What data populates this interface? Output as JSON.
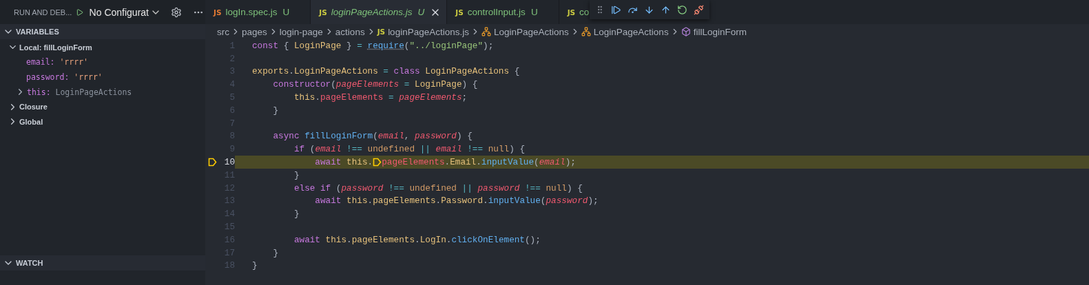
{
  "run_bar": {
    "title": "RUN AND DEB...",
    "configuration": "No Configurat"
  },
  "tabs": [
    {
      "label": "logIn.spec.js",
      "badge": "U",
      "icon": "JS",
      "color": "#e37933",
      "selected": false
    },
    {
      "label": "loginPageActions.js",
      "badge": "U",
      "icon": "JS",
      "color": "#cbcb41",
      "selected": true
    },
    {
      "label": "controlInput.js",
      "badge": "U",
      "icon": "JS",
      "color": "#cbcb41",
      "selected": false
    },
    {
      "label": "co",
      "icon": "JS",
      "color": "#cbcb41",
      "selected": false
    }
  ],
  "breadcrumbs": [
    {
      "kind": "folder",
      "label": "src"
    },
    {
      "kind": "folder",
      "label": "pages"
    },
    {
      "kind": "folder",
      "label": "login-page"
    },
    {
      "kind": "folder",
      "label": "actions"
    },
    {
      "kind": "file",
      "icon": "JS",
      "label": "loginPageActions.js"
    },
    {
      "kind": "class",
      "label": "LoginPageActions"
    },
    {
      "kind": "class",
      "label": "LoginPageActions"
    },
    {
      "kind": "method",
      "label": "fillLoginForm"
    }
  ],
  "variables": {
    "title": "VARIABLES",
    "expanded": true,
    "scopes": [
      {
        "label": "Local: fillLoginForm",
        "expanded": true,
        "children": [
          {
            "name": "email:",
            "value": "'rrrr'",
            "kind": "string"
          },
          {
            "name": "password:",
            "value": "'rrrr'",
            "kind": "string"
          },
          {
            "name": "this:",
            "value": "LoginPageActions",
            "kind": "object",
            "expanded": false
          }
        ]
      },
      {
        "label": "Closure",
        "expanded": false
      },
      {
        "label": "Global",
        "expanded": false
      }
    ]
  },
  "watch": {
    "title": "WATCH",
    "expanded": true
  },
  "code": [
    {
      "number": "1",
      "current": false,
      "tokens": [
        {
          "t": "const",
          "kind": "kw"
        },
        {
          "t": " { ",
          "kind": "plain"
        },
        {
          "t": "LoginPage",
          "kind": "var"
        },
        {
          "t": " } ",
          "kind": "plain"
        },
        {
          "t": "= ",
          "kind": "op"
        },
        {
          "t": "require",
          "kind": "fnu"
        },
        {
          "t": "(",
          "kind": "plain"
        },
        {
          "t": "\"../loginPage\"",
          "kind": "str"
        },
        {
          "t": ");",
          "kind": "plain"
        }
      ]
    },
    {
      "number": "2",
      "current": false
    },
    {
      "number": "3",
      "current": false,
      "tokens": [
        {
          "t": "exports",
          "kind": "var"
        },
        {
          "t": ".",
          "kind": "plain"
        },
        {
          "t": "LoginPageActions",
          "kind": "var"
        },
        {
          "t": " = ",
          "kind": "op"
        },
        {
          "t": "class ",
          "kind": "kw"
        },
        {
          "t": "LoginPageActions",
          "kind": "var"
        },
        {
          "t": " {",
          "kind": "plain"
        }
      ]
    },
    {
      "number": "4",
      "current": false,
      "tokens": [
        {
          "t": "    constructor",
          "kind": "kw"
        },
        {
          "t": "(",
          "kind": "plain"
        },
        {
          "t": "pageElements ",
          "kind": "param"
        },
        {
          "t": "= ",
          "kind": "op"
        },
        {
          "t": "LoginPage",
          "kind": "var"
        },
        {
          "t": ") {",
          "kind": "plain"
        }
      ]
    },
    {
      "number": "5",
      "current": false,
      "tokens": [
        {
          "t": "        this",
          "kind": "var"
        },
        {
          "t": ".",
          "kind": "plain"
        },
        {
          "t": "pageElements",
          "kind": "prop"
        },
        {
          "t": " = ",
          "kind": "op"
        },
        {
          "t": "pageElements",
          "kind": "param"
        },
        {
          "t": ";",
          "kind": "plain"
        }
      ]
    },
    {
      "number": "6",
      "current": false,
      "tokens": [
        {
          "t": "    }",
          "kind": "plain"
        }
      ]
    },
    {
      "number": "7",
      "current": false
    },
    {
      "number": "8",
      "current": false,
      "tokens": [
        {
          "t": "    async ",
          "kind": "kw"
        },
        {
          "t": "fillLoginForm",
          "kind": "fn"
        },
        {
          "t": "(",
          "kind": "plain"
        },
        {
          "t": "email",
          "kind": "param"
        },
        {
          "t": ", ",
          "kind": "plain"
        },
        {
          "t": "password",
          "kind": "param"
        },
        {
          "t": ") {",
          "kind": "plain"
        }
      ]
    },
    {
      "number": "9",
      "current": false,
      "tokens": [
        {
          "t": "        if",
          "kind": "kw"
        },
        {
          "t": " (",
          "kind": "plain"
        },
        {
          "t": "email",
          "kind": "param"
        },
        {
          "t": " !== ",
          "kind": "op"
        },
        {
          "t": "undefined",
          "kind": "const"
        },
        {
          "t": " || ",
          "kind": "op"
        },
        {
          "t": "email",
          "kind": "param"
        },
        {
          "t": " !== ",
          "kind": "op"
        },
        {
          "t": "null",
          "kind": "const"
        },
        {
          "t": ") {",
          "kind": "plain"
        }
      ]
    },
    {
      "number": "10",
      "current": true,
      "tokens": [
        {
          "t": "            await ",
          "kind": "kw"
        },
        {
          "t": "this",
          "kind": "var"
        },
        {
          "t": ".",
          "kind": "plain"
        },
        {
          "kind": "marker"
        },
        {
          "t": "pageElements",
          "kind": "prop"
        },
        {
          "t": ".",
          "kind": "plain"
        },
        {
          "t": "Email",
          "kind": "var"
        },
        {
          "t": ".",
          "kind": "plain"
        },
        {
          "t": "inputValue",
          "kind": "fn"
        },
        {
          "t": "(",
          "kind": "plain"
        },
        {
          "t": "email",
          "kind": "param"
        },
        {
          "t": ");",
          "kind": "plain"
        }
      ]
    },
    {
      "number": "11",
      "current": false,
      "tokens": [
        {
          "t": "        }",
          "kind": "plain"
        }
      ]
    },
    {
      "number": "12",
      "current": false,
      "tokens": [
        {
          "t": "        else if",
          "kind": "kw"
        },
        {
          "t": " (",
          "kind": "plain"
        },
        {
          "t": "password",
          "kind": "param"
        },
        {
          "t": " !== ",
          "kind": "op"
        },
        {
          "t": "undefined",
          "kind": "const"
        },
        {
          "t": " || ",
          "kind": "op"
        },
        {
          "t": "password",
          "kind": "param"
        },
        {
          "t": " !== ",
          "kind": "op"
        },
        {
          "t": "null",
          "kind": "const"
        },
        {
          "t": ") {",
          "kind": "plain"
        }
      ]
    },
    {
      "number": "13",
      "current": false,
      "tokens": [
        {
          "t": "            await ",
          "kind": "kw"
        },
        {
          "t": "this",
          "kind": "var"
        },
        {
          "t": ".",
          "kind": "plain"
        },
        {
          "t": "pageElements",
          "kind": "var"
        },
        {
          "t": ".",
          "kind": "plain"
        },
        {
          "t": "Password",
          "kind": "var"
        },
        {
          "t": ".",
          "kind": "plain"
        },
        {
          "t": "inputValue",
          "kind": "fn"
        },
        {
          "t": "(",
          "kind": "plain"
        },
        {
          "t": "password",
          "kind": "param"
        },
        {
          "t": ");",
          "kind": "plain"
        }
      ]
    },
    {
      "number": "14",
      "current": false,
      "tokens": [
        {
          "t": "        }",
          "kind": "plain"
        }
      ]
    },
    {
      "number": "15",
      "current": false
    },
    {
      "number": "16",
      "current": false,
      "tokens": [
        {
          "t": "        await ",
          "kind": "kw"
        },
        {
          "t": "this",
          "kind": "var"
        },
        {
          "t": ".",
          "kind": "plain"
        },
        {
          "t": "pageElements",
          "kind": "var"
        },
        {
          "t": ".",
          "kind": "plain"
        },
        {
          "t": "LogIn",
          "kind": "var"
        },
        {
          "t": ".",
          "kind": "plain"
        },
        {
          "t": "clickOnElement",
          "kind": "fn"
        },
        {
          "t": "();",
          "kind": "plain"
        }
      ]
    },
    {
      "number": "17",
      "current": false,
      "tokens": [
        {
          "t": "    }",
          "kind": "plain"
        }
      ]
    },
    {
      "number": "18",
      "current": false,
      "tokens": [
        {
          "t": "}",
          "kind": "plain"
        }
      ]
    }
  ]
}
